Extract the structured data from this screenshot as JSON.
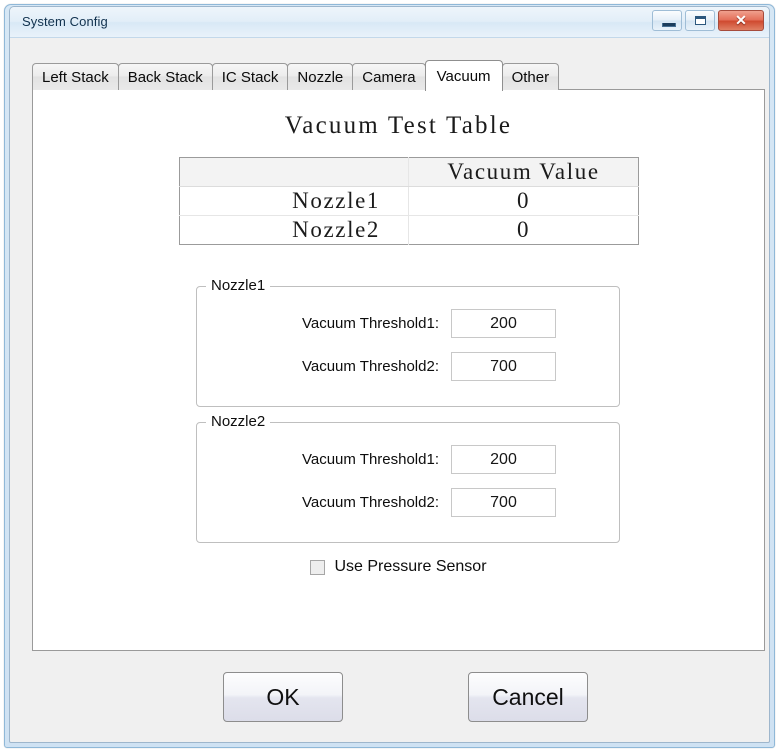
{
  "window": {
    "title": "System Config",
    "controls": {
      "minimize": "minimize",
      "maximize": "maximize",
      "close": "✕"
    }
  },
  "tabs": [
    {
      "label": "Left Stack",
      "active": false
    },
    {
      "label": "Back Stack",
      "active": false
    },
    {
      "label": "IC Stack",
      "active": false
    },
    {
      "label": "Nozzle",
      "active": false
    },
    {
      "label": "Camera",
      "active": false
    },
    {
      "label": "Vacuum",
      "active": true
    },
    {
      "label": "Other",
      "active": false
    }
  ],
  "vacuum_tab": {
    "table": {
      "title": "Vacuum Test Table",
      "columns": [
        "",
        "Vacuum Value"
      ],
      "rows": [
        {
          "name": "Nozzle1",
          "value": "0"
        },
        {
          "name": "Nozzle2",
          "value": "0"
        }
      ]
    },
    "groups": [
      {
        "legend": "Nozzle1",
        "fields": [
          {
            "label": "Vacuum Threshold1:",
            "value": "200"
          },
          {
            "label": "Vacuum Threshold2:",
            "value": "700"
          }
        ]
      },
      {
        "legend": "Nozzle2",
        "fields": [
          {
            "label": "Vacuum Threshold1:",
            "value": "200"
          },
          {
            "label": "Vacuum Threshold2:",
            "value": "700"
          }
        ]
      }
    ],
    "checkbox": {
      "label": "Use Pressure Sensor",
      "checked": false
    }
  },
  "footer": {
    "ok_label": "OK",
    "cancel_label": "Cancel"
  },
  "colors": {
    "frame": "#cfe2f3",
    "dialog_bg": "#f0f0f0",
    "panel_bg": "#ffffff",
    "close_button": "#cf4a30",
    "tab_inactive": "#e9e9e9",
    "tab_active": "#ffffff"
  }
}
